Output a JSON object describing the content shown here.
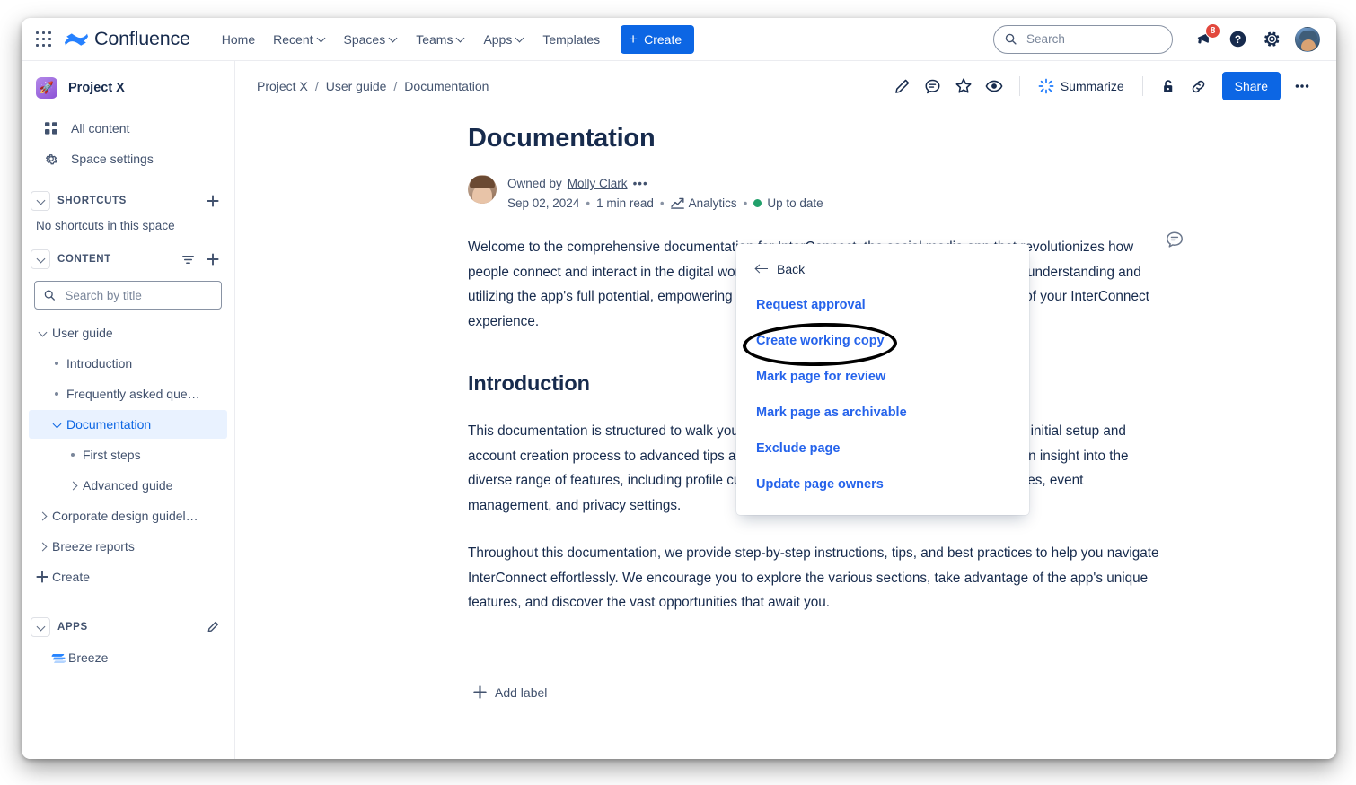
{
  "topnav": {
    "app_switcher_icon": "grid-apps-icon",
    "brand": "Confluence",
    "items": [
      {
        "label": "Home",
        "has_caret": false
      },
      {
        "label": "Recent",
        "has_caret": true
      },
      {
        "label": "Spaces",
        "has_caret": true
      },
      {
        "label": "Teams",
        "has_caret": true
      },
      {
        "label": "Apps",
        "has_caret": true
      },
      {
        "label": "Templates",
        "has_caret": false
      }
    ],
    "create_label": "Create",
    "search_placeholder": "Search",
    "search_value": "",
    "notifications_count": "8",
    "help_label": "?",
    "settings_icon": "gear-icon"
  },
  "sidebar": {
    "space_name": "Project X",
    "space_emoji": "🚀",
    "nav": [
      {
        "label": "All content",
        "icon": "grid-content-icon"
      },
      {
        "label": "Space settings",
        "icon": "gear-icon"
      }
    ],
    "shortcuts": {
      "title": "SHORTCUTS",
      "empty_text": "No shortcuts in this space",
      "add_label": "+"
    },
    "content": {
      "title": "CONTENT",
      "search_placeholder": "Search by title",
      "search_value": ""
    },
    "tree": [
      {
        "label": "User guide",
        "level": 0,
        "twisty": "chevron-down",
        "active": false
      },
      {
        "label": "Introduction",
        "level": 1,
        "twisty": "dot",
        "active": false
      },
      {
        "label": "Frequently asked que…",
        "level": 1,
        "twisty": "dot",
        "active": false
      },
      {
        "label": "Documentation",
        "level": 1,
        "twisty": "chevron-down",
        "active": true
      },
      {
        "label": "First steps",
        "level": 2,
        "twisty": "dot",
        "active": false
      },
      {
        "label": "Advanced guide",
        "level": 2,
        "twisty": "chevron-right",
        "active": false
      },
      {
        "label": "Corporate design guidel…",
        "level": 0,
        "twisty": "chevron-right",
        "active": false
      },
      {
        "label": "Breeze reports",
        "level": 0,
        "twisty": "chevron-right",
        "active": false
      },
      {
        "label": "Create",
        "level": 0,
        "twisty": "plus",
        "active": false
      }
    ],
    "apps": {
      "title": "APPS",
      "edit_icon": "pencil-icon",
      "items": [
        {
          "label": "Breeze",
          "icon": "breeze-icon"
        }
      ]
    }
  },
  "pagebar": {
    "breadcrumb": [
      "Project X",
      "User guide",
      "Documentation"
    ],
    "tools": [
      {
        "name": "edit-pencil-icon"
      },
      {
        "name": "comment-icon"
      },
      {
        "name": "star-icon"
      },
      {
        "name": "watch-eye-icon"
      }
    ],
    "summarize_label": "Summarize",
    "restrictions_icon": "unlock-icon",
    "copy_link_icon": "link-icon",
    "share_label": "Share",
    "more_label": "•••"
  },
  "page": {
    "title": "Documentation",
    "owned_by_prefix": "Owned by",
    "owner": "Molly Clark",
    "owner_more": "•••",
    "date": "Sep 02, 2024",
    "read_time": "1 min read",
    "analytics_label": "Analytics",
    "status_label": "Up to date",
    "status_color": "#22a06b",
    "paragraphs": [
      "Welcome to the comprehensive documentation for InterConnect, the social media app that revolutionizes how people connect and interact in the digital world. This documentation serves as your guide to understanding and utilizing the app's full potential, empowering you to navigate its features and make the most of your InterConnect experience.",
      "This documentation is structured to walk you through every aspect of InterConnect, from the initial setup and account creation process to advanced tips and tricks for maximizing its potential. You will gain insight into the diverse range of features, including profile customization, messaging, groups and communities, event management, and privacy settings.",
      "Throughout this documentation, we provide step-by-step instructions, tips, and best practices to help you navigate InterConnect effortlessly. We encourage you to explore the various sections, take advantage of the app's unique features, and discover the vast opportunities that await you."
    ],
    "section_heading": "Introduction",
    "add_label": "Add label",
    "inline_comment_icon": "comment-bubble-icon"
  },
  "popup": {
    "back_label": "Back",
    "items": [
      "Request approval",
      "Create working copy",
      "Mark page for review",
      "Mark page as archivable",
      "Exclude page",
      "Update page owners"
    ],
    "highlighted_item": "Create working copy"
  },
  "colors": {
    "brand_blue": "#0c66e4",
    "link_blue": "#2563eb",
    "text_dark": "#172b4d",
    "text_muted": "#42526e",
    "selected_bg": "#e9f2ff",
    "badge_red": "#e2483d",
    "status_green": "#22a06b",
    "highlight_ring": "#000000"
  }
}
